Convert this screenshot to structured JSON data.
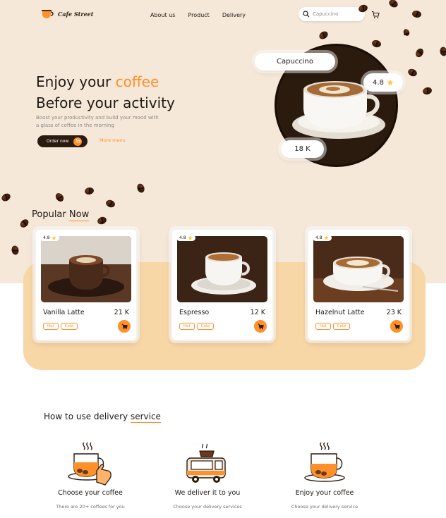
{
  "brand": {
    "logo_text_1": "Cafe",
    "logo_text_2": "Street"
  },
  "nav": {
    "links": [
      "About us",
      "Product",
      "Delivery"
    ]
  },
  "search": {
    "placeholder": "Capuccino"
  },
  "hero": {
    "title_1": "Enjoy your",
    "title_accent": "coffee",
    "title_2": "Before your activity",
    "subtitle": "Boost your productivity and build your mood with a glass of coffee in the morning",
    "order_label": "Order now",
    "more_label": "More menu",
    "featured_name": "Capuccino",
    "featured_rating": "4.8",
    "featured_price": "18 K"
  },
  "popular": {
    "title_1": "Popular",
    "title_accent": "Now",
    "items": [
      {
        "name": "Vanilla Latte",
        "price": "21 K",
        "rating": "4.8",
        "tags": [
          "Hot",
          "Cold"
        ]
      },
      {
        "name": "Espresso",
        "price": "12 K",
        "rating": "4.8",
        "tags": [
          "Hot",
          "Cold"
        ]
      },
      {
        "name": "Hazelnut Latte",
        "price": "23 K",
        "rating": "4.8",
        "tags": [
          "Hot",
          "Cold"
        ]
      }
    ]
  },
  "delivery": {
    "title_1": "How to use delivery",
    "title_accent": "service",
    "steps": [
      {
        "title": "Choose your coffee",
        "desc": "There are 20+ coffees for you",
        "icon": "coffee-hand-icon"
      },
      {
        "title": "We deliver it to you",
        "desc": "Choose your delivery services",
        "icon": "delivery-truck-icon"
      },
      {
        "title": "Enjoy your coffee",
        "desc": "Choose your delivery service",
        "icon": "coffee-cup-icon"
      }
    ]
  },
  "colors": {
    "accent": "#ff902a",
    "dark": "#2b1a0e",
    "hero_bg": "#f6e8d8",
    "panel": "#f8d7a7"
  }
}
